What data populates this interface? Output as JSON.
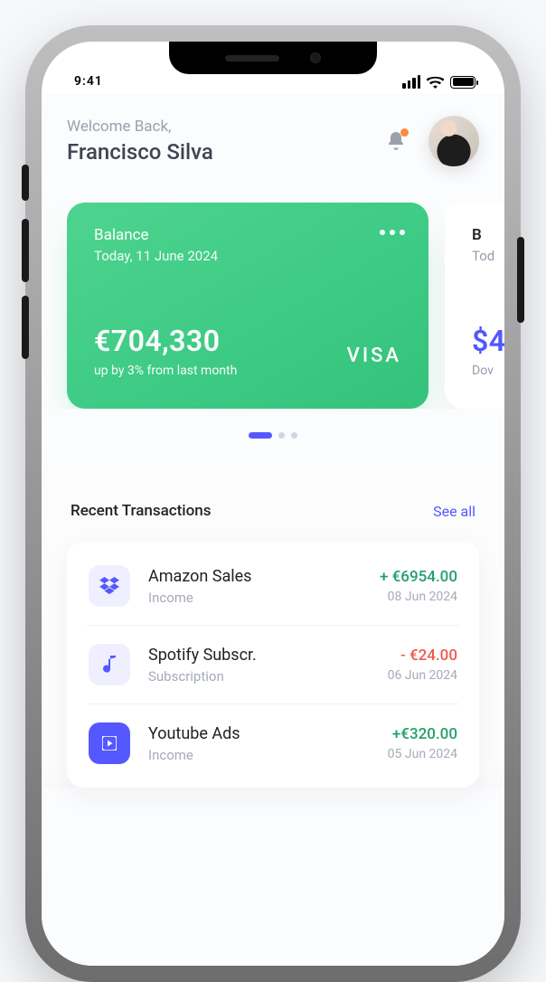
{
  "status": {
    "time": "9:41"
  },
  "header": {
    "welcome": "Welcome Back,",
    "name": "Francisco Silva"
  },
  "cards": [
    {
      "label": "Balance",
      "date": "Today, 11 June 2024",
      "amount": "€704,330",
      "sub": "up by 3% from last month",
      "brand": "VISA"
    },
    {
      "label": "B",
      "date": "Tod",
      "amount": "$4",
      "sub": "Dov"
    }
  ],
  "transactions": {
    "title": "Recent Transactions",
    "see_all": "See all",
    "items": [
      {
        "name": "Amazon Sales",
        "category": "Income",
        "amount": "+ €6954.00",
        "date": "08 Jun 2024",
        "dir": "pos",
        "icon": "dropbox"
      },
      {
        "name": "Spotify Subscr.",
        "category": "Subscription",
        "amount": "- €24.00",
        "date": "06 Jun 2024",
        "dir": "neg",
        "icon": "music"
      },
      {
        "name": "Youtube Ads",
        "category": "Income",
        "amount": "+€320.00",
        "date": "05 Jun 2024",
        "dir": "pos",
        "icon": "play"
      }
    ]
  }
}
